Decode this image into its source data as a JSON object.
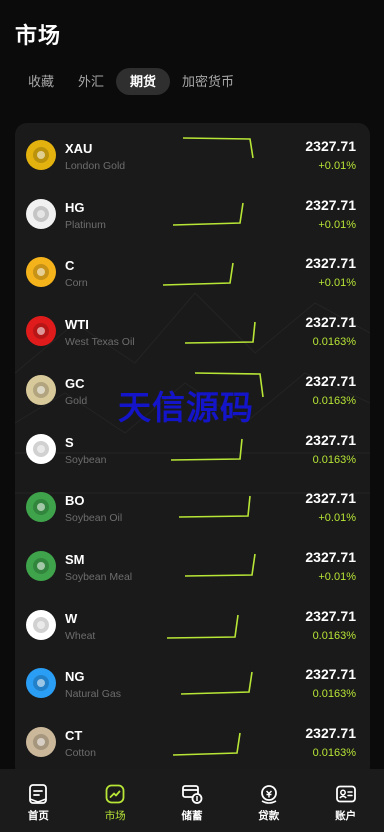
{
  "header": {
    "title": "市场"
  },
  "tabs": [
    {
      "label": "收藏"
    },
    {
      "label": "外汇"
    },
    {
      "label": "期货",
      "active": true
    },
    {
      "label": "加密货币"
    }
  ],
  "colors": {
    "accent": "#b8e636",
    "background": "#0b0b0b",
    "card": "#1a1a1a",
    "watermark": "#1414c8"
  },
  "markets": [
    {
      "symbol": "XAU",
      "name": "London Gold",
      "price": "2327.71",
      "change": "+0.01%",
      "icon": "gold-bar-icon",
      "color": "#e3b20f"
    },
    {
      "symbol": "HG",
      "name": "Platinum",
      "price": "2327.71",
      "change": "+0.01%",
      "icon": "platinum-icon",
      "color": "#f1f1f1"
    },
    {
      "symbol": "C",
      "name": "Corn",
      "price": "2327.71",
      "change": "+0.01%",
      "icon": "corn-icon",
      "color": "#f4b21b"
    },
    {
      "symbol": "WTI",
      "name": "West Texas Oil",
      "price": "2327.71",
      "change": "0.0163%",
      "icon": "oil-drop-icon",
      "color": "#e01b1b"
    },
    {
      "symbol": "GC",
      "name": "Gold",
      "price": "2327.71",
      "change": "0.0163%",
      "icon": "gold-coin-icon",
      "color": "#d8c99a"
    },
    {
      "symbol": "S",
      "name": "Soybean",
      "price": "2327.71",
      "change": "0.0163%",
      "icon": "soybean-icon",
      "color": "#ffffff"
    },
    {
      "symbol": "BO",
      "name": "Soybean Oil",
      "price": "2327.71",
      "change": "+0.01%",
      "icon": "soybean-oil-icon",
      "color": "#3ea34a"
    },
    {
      "symbol": "SM",
      "name": "Soybean Meal",
      "price": "2327.71",
      "change": "+0.01%",
      "icon": "soybean-meal-icon",
      "color": "#3ea34a"
    },
    {
      "symbol": "W",
      "name": "Wheat",
      "price": "2327.71",
      "change": "0.0163%",
      "icon": "wheat-icon",
      "color": "#ffffff"
    },
    {
      "symbol": "NG",
      "name": "Natural Gas",
      "price": "2327.71",
      "change": "0.0163%",
      "icon": "gas-flame-icon",
      "color": "#2a9df4"
    },
    {
      "symbol": "CT",
      "name": "Cotton",
      "price": "2327.71",
      "change": "0.0163%",
      "icon": "cotton-icon",
      "color": "#cbb89a"
    }
  ],
  "watermark": "天信源码",
  "nav": [
    {
      "label": "首页",
      "icon": "home-doc-icon"
    },
    {
      "label": "市场",
      "icon": "market-chart-icon",
      "active": true
    },
    {
      "label": "储蓄",
      "icon": "savings-icon"
    },
    {
      "label": "贷款",
      "icon": "loan-icon"
    },
    {
      "label": "账户",
      "icon": "account-card-icon"
    }
  ]
}
